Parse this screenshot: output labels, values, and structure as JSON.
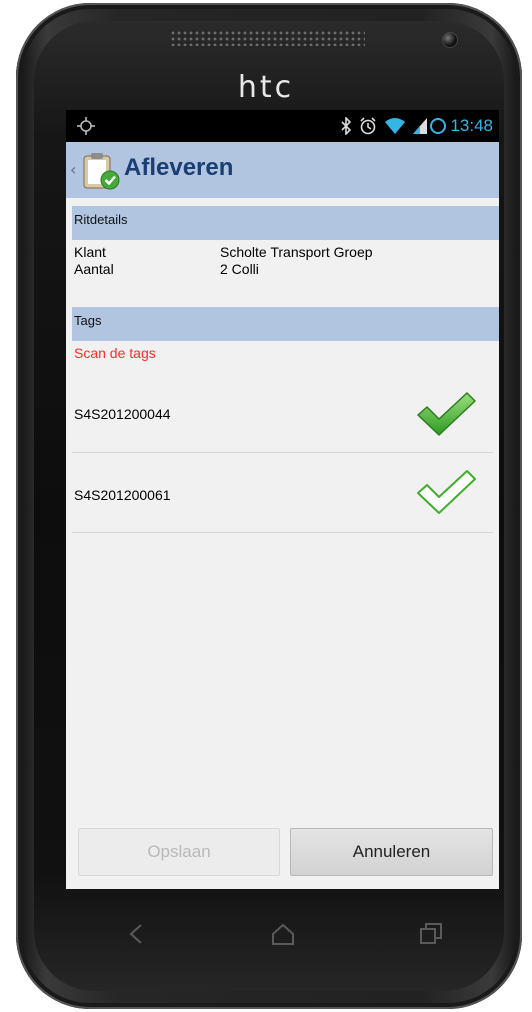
{
  "device": {
    "brand": "htc"
  },
  "status_bar": {
    "time": "13:48",
    "icons": [
      "location-icon",
      "bluetooth-icon",
      "alarm-icon",
      "wifi-icon",
      "signal-icon",
      "sync-icon"
    ]
  },
  "action_bar": {
    "title": "Afleveren",
    "icon": "clipboard-check-icon"
  },
  "ritdetails": {
    "header": "Ritdetails",
    "rows": [
      {
        "label": "Klant",
        "value": "Scholte Transport Groep"
      },
      {
        "label": "Aantal",
        "value": "2 Colli"
      }
    ]
  },
  "tags": {
    "header": "Tags",
    "hint": "Scan de tags",
    "items": [
      {
        "code": "S4S201200044",
        "scanned": true
      },
      {
        "code": "S4S201200061",
        "scanned": false
      }
    ]
  },
  "buttons": {
    "save": "Opslaan",
    "cancel": "Annuleren"
  },
  "colors": {
    "accent": "#b1c4e0",
    "title": "#1b3f73",
    "hint": "#ff2a2a",
    "status": "#33b5e5",
    "check": "#3fae2a"
  }
}
